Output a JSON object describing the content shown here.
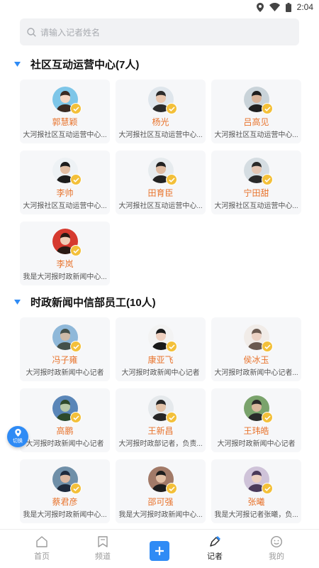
{
  "status": {
    "time": "2:04"
  },
  "search": {
    "placeholder": "请输入记者姓名"
  },
  "sections": [
    {
      "title": "社区互动运营中心(7人)",
      "members": [
        {
          "name": "郭慧颖",
          "desc": "大河报社区互动运营中心..."
        },
        {
          "name": "杨光",
          "desc": "大河报社区互动运营中心..."
        },
        {
          "name": "吕高见",
          "desc": "大河报社区互动运营中心..."
        },
        {
          "name": "李帅",
          "desc": "大河报社区互动运营中心..."
        },
        {
          "name": "田育臣",
          "desc": "大河报社区互动运营中心..."
        },
        {
          "name": "宁田甜",
          "desc": "大河报社区互动运营中心..."
        },
        {
          "name": "李岚",
          "desc": "我是大河报时政新闻中心..."
        }
      ]
    },
    {
      "title": "时政新闻中信部员工(10人)",
      "members": [
        {
          "name": "冯子雍",
          "desc": "大河报时政新闻中心记者"
        },
        {
          "name": "康亚飞",
          "desc": "大河报时政新闻中心记者"
        },
        {
          "name": "侯冰玉",
          "desc": "大河报时政新闻中心记者..."
        },
        {
          "name": "高鹏",
          "desc": "大河报时政新闻中心记者"
        },
        {
          "name": "王新昌",
          "desc": "大河报时政部记者，负责..."
        },
        {
          "name": "王玮皓",
          "desc": "大河报时政新闻中心记者"
        },
        {
          "name": "蔡君彦",
          "desc": "我是大河报时政新闻中心..."
        },
        {
          "name": "邵可强",
          "desc": "我是大河报时政新闻中心..."
        },
        {
          "name": "张曦",
          "desc": "我是大河报记者张曦，负..."
        }
      ]
    }
  ],
  "float_button": {
    "label": "切换",
    "icon": "location-pin-icon"
  },
  "tabs": [
    {
      "label": "首页",
      "icon": "home-icon",
      "active": false
    },
    {
      "label": "频道",
      "icon": "bookmark-icon",
      "active": false
    },
    {
      "label": "记者",
      "icon": "reporter-pen-icon",
      "active": true
    },
    {
      "label": "我的",
      "icon": "smiley-icon",
      "active": false
    }
  ],
  "colors": {
    "accent": "#2f8bf5",
    "name_orange": "#e8732c",
    "badge_gold": "#f3c03a",
    "card_bg": "#f6f7f9"
  }
}
